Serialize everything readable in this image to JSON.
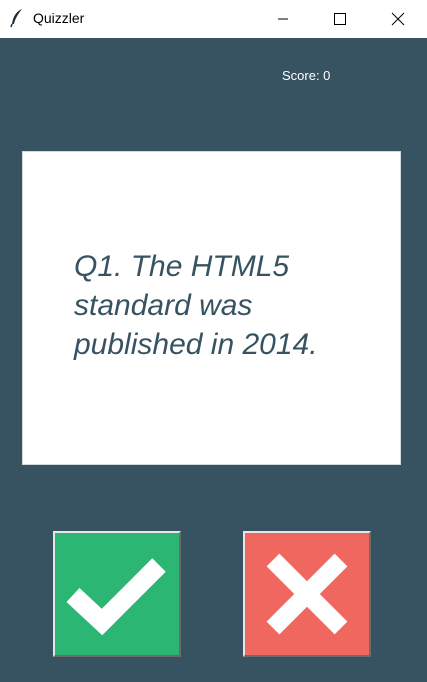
{
  "window": {
    "title": "Quizzler"
  },
  "score": {
    "text": "Score: 0"
  },
  "question": {
    "text": "Q1. The HTML5 standard was published in 2014."
  },
  "buttons": {
    "true_icon": "checkmark-icon",
    "false_icon": "cross-icon"
  },
  "colors": {
    "background": "#375362",
    "card": "#ffffff",
    "question_text": "#375362",
    "true_button": "#2bb673",
    "false_button": "#f0675f"
  }
}
